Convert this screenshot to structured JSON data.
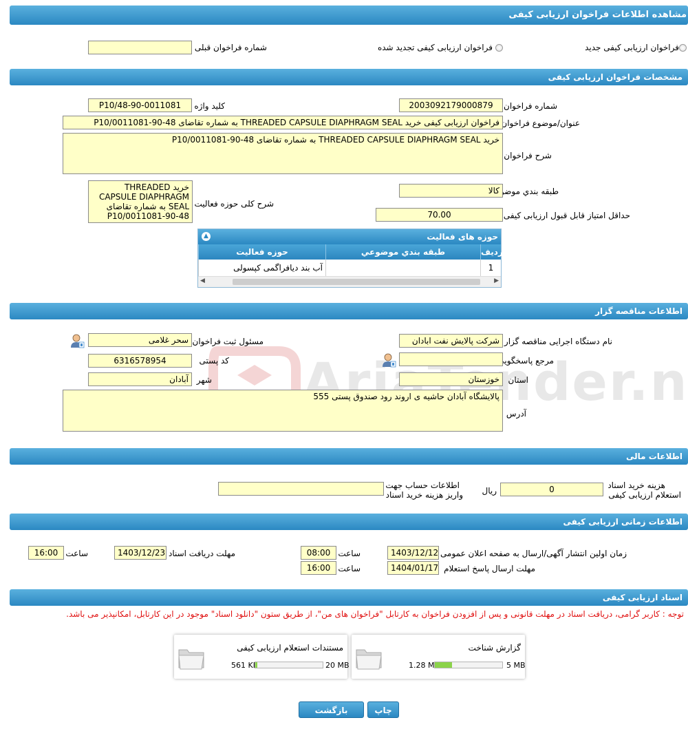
{
  "header": {
    "title": "مشاهده اطلاعات فراخوان ارزیابی کیفی"
  },
  "type_options": {
    "new": "فراخوان ارزیابی کیفی جدید",
    "renewed": "فراخوان ارزیابی کیفی تجدید شده",
    "prev_number_label": "شماره فراخوان قبلی",
    "prev_number_value": ""
  },
  "spec": {
    "section_title": "مشخصات فراخوان ارزیابی کیفی",
    "number_label": "شماره فراخوان",
    "number_value": "2003092179000879",
    "keyword_label": "کلید واژه",
    "keyword_value": "P10/48-90-0011081",
    "subject_label": "عنوان/موضوع فراخوان",
    "subject_value": "فراخوان ارزیابی کیفی خرید THREADED CAPSULE DIAPHRAGM SEAL  به شماره تقاضای 48-90-P10/0011081",
    "desc_label": "شرح فراخوان",
    "desc_value": "خرید THREADED CAPSULE DIAPHRAGM SEAL  به شماره تقاضای 48-90-P10/0011081",
    "category_label": "طبقه بندي موضوعي",
    "category_value": "کالا",
    "activity_desc_label": "شرح کلی حوزه فعالیت",
    "activity_desc_value": "خرید THREADED CAPSULE DIAPHRAGM SEAL  به شماره تقاضای 48-90-P10/0011081",
    "min_score_label": "حداقل امتیاز قابل قبول ارزیابی کیفی",
    "min_score_value": "70.00",
    "grid": {
      "title": "حوزه های فعالیت",
      "col_row": "ردیف",
      "col_category": "طبقه بندي موضوعي",
      "col_activity": "حوزه فعالیت",
      "row_index": "1",
      "row_category": "",
      "row_activity": "آب بند دیافراگمی کپسولی"
    }
  },
  "organizer": {
    "section_title": "اطلاعات مناقصه گزار",
    "org_name_label": "نام دستگاه اجرایی مناقصه گزار",
    "org_name_value": "شرکت پالایش نفت ابادان",
    "responsible_label": "مسئول ثبت فراخوان",
    "responsible_value": "سحر غلامی",
    "ref_label": "مرجع پاسخگویی",
    "ref_value": "",
    "postal_label": "کد پستی",
    "postal_value": "6316578954",
    "province_label": "استان",
    "province_value": "خوزستان",
    "city_label": "شهر",
    "city_value": "آبادان",
    "address_label": "آدرس",
    "address_value": "پالایشگاه آبادان حاشیه ی اروند رود صندوق پستی 555"
  },
  "financial": {
    "section_title": "اطلاعات مالی",
    "fee_label_1": "هزینه خرید اسناد",
    "fee_label_2": "استعلام ارزیابی کیفی",
    "fee_value": "0",
    "currency": "ریال",
    "account_label_1": "اطلاعات حساب جهت",
    "account_label_2": "واریز هزینه خرید اسناد",
    "account_value": ""
  },
  "timing": {
    "section_title": "اطلاعات زمانی ارزیابی کیفی",
    "publish_label": "زمان اولین انتشار آگهی/ارسال به صفحه اعلان عمومی",
    "publish_date": "1403/12/12",
    "time_label": "ساعت",
    "publish_time": "08:00",
    "receive_label": "مهلت دریافت اسناد",
    "receive_date": "1403/12/23",
    "receive_time": "16:00",
    "reply_label": "مهلت ارسال پاسخ استعلام",
    "reply_date": "1404/01/17",
    "reply_time": "16:00"
  },
  "documents": {
    "section_title": "اسناد ارزیابی کیفی",
    "note": "توجه : کاربر گرامی، دریافت اسناد در مهلت قانونی و پس از افزودن فراخوان به کارتابل \"فراخوان های من\"، از طریق ستون \"دانلود اسناد\" موجود در این کارتابل، امکانپذیر می باشد.",
    "doc1": {
      "name": "گزارش شناخت",
      "size": "1.28 MB",
      "max": "5 MB",
      "fill": 0.256
    },
    "doc2": {
      "name": "مستندات استعلام ارزیابی کیفی",
      "size": "561 KB",
      "max": "20 MB",
      "fill": 0.027
    }
  },
  "buttons": {
    "print": "چاپ",
    "back": "بازگشت"
  },
  "watermark": "AriaTender.neT",
  "colors": {
    "bar": "#2b88c2",
    "field_bg": "#ffffc8",
    "note": "#e01010",
    "progress": "#8bd34a"
  }
}
